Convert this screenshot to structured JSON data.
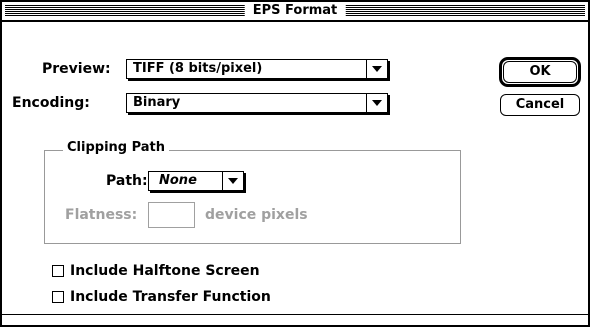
{
  "dialog": {
    "title": "EPS Format",
    "preview": {
      "label": "Preview:",
      "value": "TIFF  (8 bits/pixel)"
    },
    "encoding": {
      "label": "Encoding:",
      "value": "Binary"
    },
    "clipping_path": {
      "title": "Clipping Path",
      "path_label": "Path:",
      "path_value": "None",
      "flatness_label": "Flatness:",
      "flatness_value": "",
      "flatness_unit": "device pixels"
    },
    "checkboxes": [
      {
        "label": "Include Halftone Screen",
        "checked": false
      },
      {
        "label": "Include Transfer Function",
        "checked": false
      }
    ],
    "buttons": {
      "ok": "OK",
      "cancel": "Cancel"
    }
  }
}
